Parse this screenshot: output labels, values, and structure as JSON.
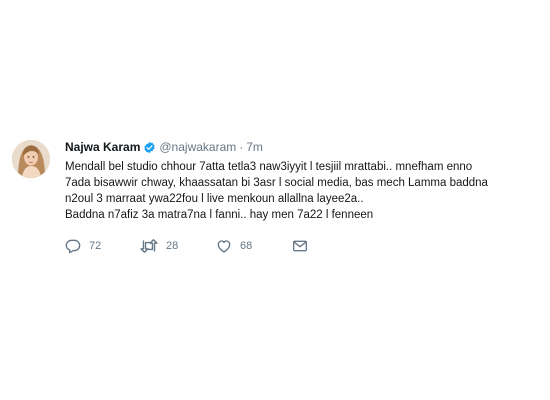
{
  "tweet": {
    "author": {
      "display_name": "Najwa Karam",
      "handle": "@najwakaram",
      "verified": true
    },
    "separator": "·",
    "timestamp": "7m",
    "text": "Mendall bel studio chhour 7atta tetla3 naw3iyyit l tesjiil mrattabi.. mnefham enno\n7ada bisawwir chway, khaassatan bi 3asr l social media, bas mech Lamma baddna\nn2oul 3 marraat ywa22fou l live menkoun allallna layee2a..\nBaddna n7afiz 3a matra7na l fanni.. hay men 7a22 l fenneen",
    "actions": {
      "replies": "72",
      "retweets": "28",
      "likes": "68"
    },
    "icons": {
      "reply": "reply-icon",
      "retweet": "retweet-icon",
      "like": "heart-icon",
      "dm": "envelope-icon",
      "verified": "verified-badge-icon"
    },
    "colors": {
      "verified": "#1da1f2",
      "secondary_text": "#657786",
      "primary_text": "#14171a"
    }
  }
}
